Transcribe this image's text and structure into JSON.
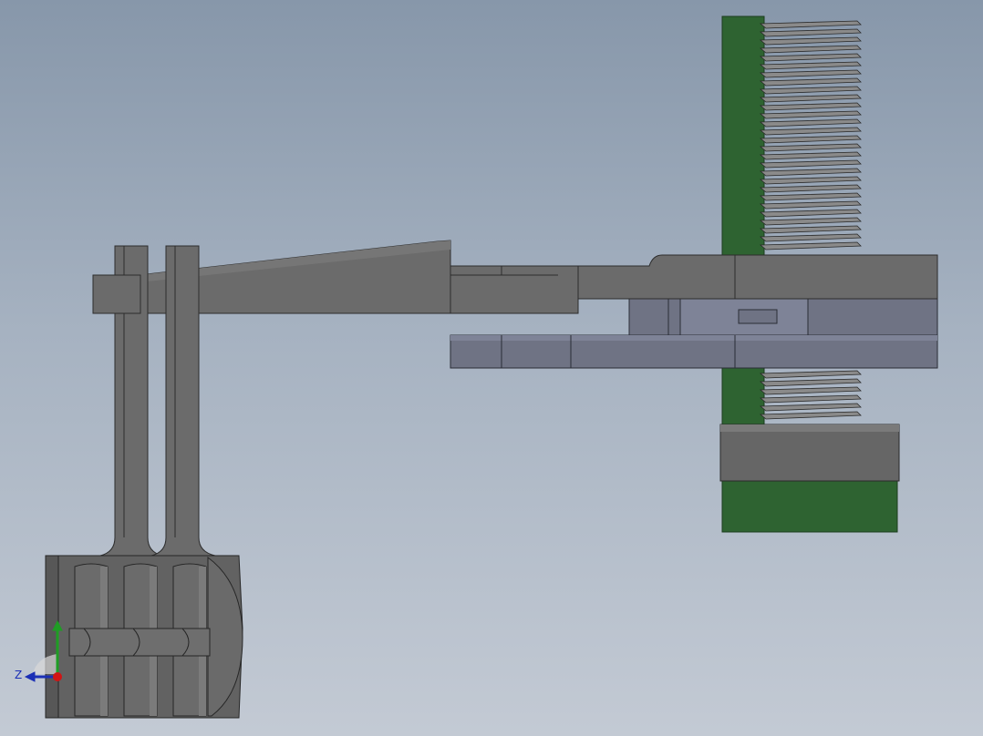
{
  "viewport": {
    "background_top": "#8797aa",
    "background_bottom": "#c3cad4"
  },
  "colors": {
    "arm": "#6b6b6b",
    "arm_edge": "#2c2c2c",
    "slider": "#6f7384",
    "slider_light": "#7e8397",
    "rail_green": "#2e6331",
    "thread": "#8a8a8a",
    "clamp": "#666666"
  },
  "triad": {
    "z_label": "Z",
    "axis_z_color": "#1b2fb5",
    "axis_y_color": "#1f9d24",
    "axis_x_color": "#d11414",
    "icons": [
      "orientation-triad-icon"
    ]
  }
}
